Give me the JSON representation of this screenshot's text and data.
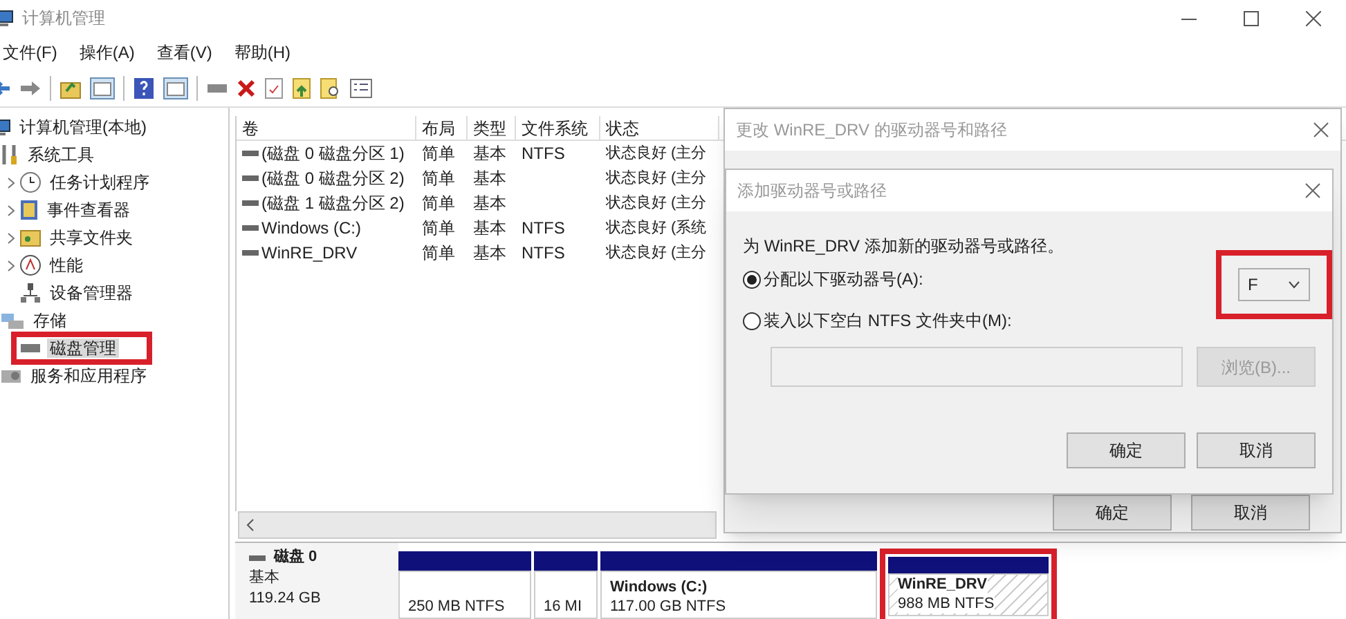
{
  "window": {
    "title": "计算机管理"
  },
  "menu": [
    "文件(F)",
    "操作(A)",
    "查看(V)",
    "帮助(H)"
  ],
  "tree": [
    {
      "label": "计算机管理(本地)",
      "selected": false,
      "children": [
        {
          "label": "系统工具",
          "selected": false,
          "children": [
            {
              "label": "任务计划程序",
              "collapsed": true,
              "selected": false
            },
            {
              "label": "事件查看器",
              "collapsed": true,
              "selected": false
            },
            {
              "label": "共享文件夹",
              "collapsed": true,
              "selected": false
            },
            {
              "label": "性能",
              "collapsed": true,
              "selected": false
            },
            {
              "label": "设备管理器",
              "selected": false
            }
          ]
        },
        {
          "label": "存储",
          "selected": false,
          "children": [
            {
              "label": "磁盘管理",
              "selected": true
            }
          ]
        },
        {
          "label": "服务和应用程序",
          "selected": false
        }
      ]
    }
  ],
  "volume_table": {
    "columns": [
      "卷",
      "布局",
      "类型",
      "文件系统",
      "状态"
    ],
    "rows": [
      {
        "volume": "(磁盘 0 磁盘分区 1)",
        "layout": "简单",
        "type": "基本",
        "file_system": "NTFS",
        "status": "状态良好 (主分"
      },
      {
        "volume": "(磁盘 0 磁盘分区 2)",
        "layout": "简单",
        "type": "基本",
        "status": "状态良好 (主分"
      },
      {
        "volume": "(磁盘 1 磁盘分区 2)",
        "layout": "简单",
        "type": "基本",
        "status": "状态良好 (主分"
      },
      {
        "volume": "Windows (C:)",
        "layout": "简单",
        "type": "基本",
        "file_system": "NTFS",
        "status": "状态良好 (系统"
      },
      {
        "volume": "WinRE_DRV",
        "layout": "简单",
        "type": "基本",
        "file_system": "NTFS",
        "status": "状态良好 (主分"
      }
    ]
  },
  "disk_map": {
    "disk": {
      "name": "磁盘 0",
      "type": "基本",
      "size": "119.24 GB"
    },
    "partitions": [
      {
        "size": "250 MB NTFS",
        "selected": false
      },
      {
        "size": "16 MI",
        "selected": false
      },
      {
        "name": "Windows (C:)",
        "size": "117.00 GB NTFS",
        "selected": false
      },
      {
        "name": "WinRE_DRV",
        "size": "988 MB NTFS",
        "selected": true
      }
    ]
  },
  "dialogs": [
    {
      "title": "更改 WinRE_DRV 的驱动器号和路径",
      "buttons": [
        "确定",
        "取消"
      ]
    },
    {
      "title": "添加驱动器号或路径",
      "prompt": "为 WinRE_DRV 添加新的驱动器号或路径。",
      "options": [
        {
          "label": "分配以下驱动器号(A):",
          "selected": true
        },
        {
          "label": "装入以下空白 NTFS 文件夹中(M):",
          "selected": false
        }
      ],
      "drive_letter": "F",
      "browse_button": {
        "label": "浏览(B)...",
        "disabled": true
      },
      "buttons": [
        "确定",
        "取消"
      ]
    }
  ]
}
